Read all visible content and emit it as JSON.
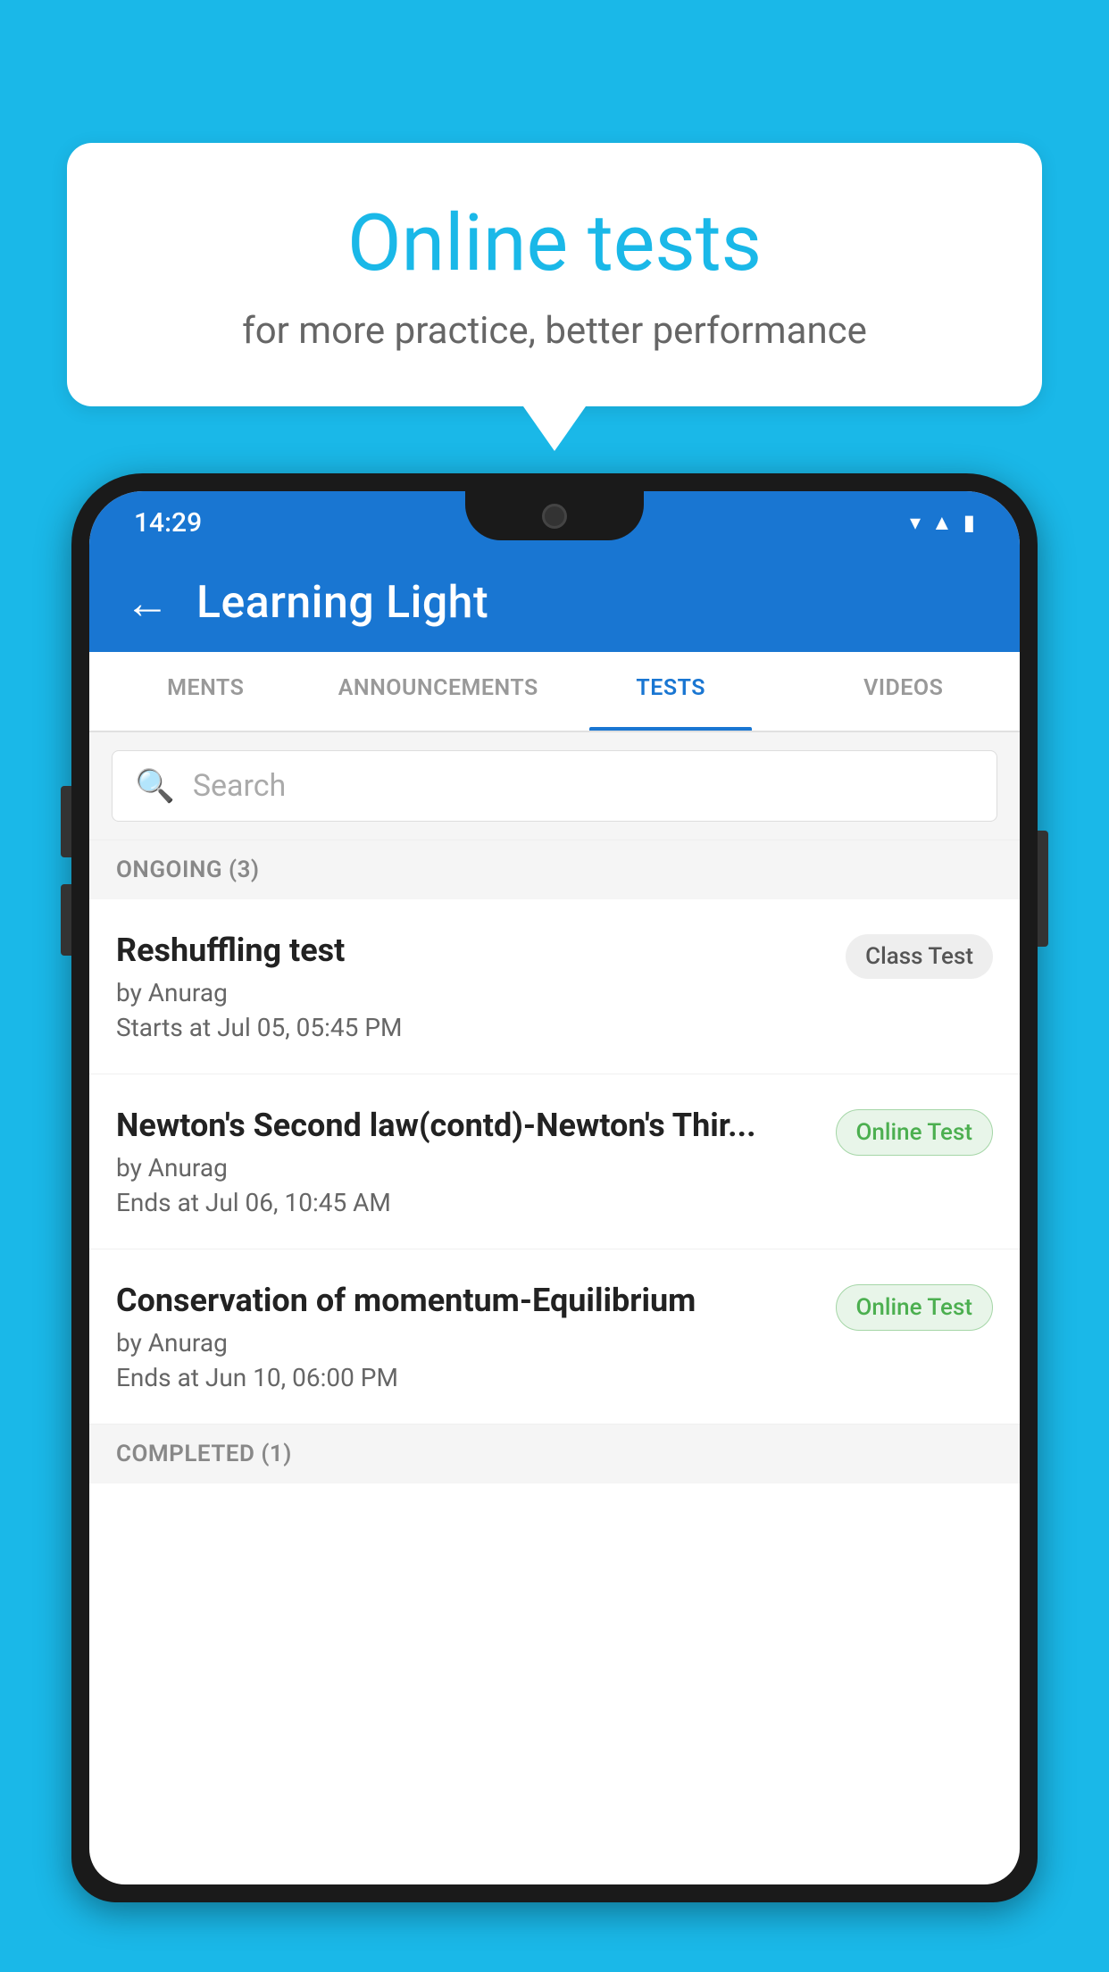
{
  "background_color": "#1ab8e8",
  "speech_bubble": {
    "title": "Online tests",
    "subtitle": "for more practice, better performance"
  },
  "phone": {
    "status_bar": {
      "time": "14:29",
      "icons": [
        "wifi",
        "signal",
        "battery"
      ]
    },
    "app_bar": {
      "title": "Learning Light",
      "back_label": "←"
    },
    "tabs": [
      {
        "label": "MENTS",
        "active": false
      },
      {
        "label": "ANNOUNCEMENTS",
        "active": false
      },
      {
        "label": "TESTS",
        "active": true
      },
      {
        "label": "VIDEOS",
        "active": false
      }
    ],
    "search": {
      "placeholder": "Search"
    },
    "sections": [
      {
        "header": "ONGOING (3)",
        "items": [
          {
            "title": "Reshuffling test",
            "author": "by Anurag",
            "date": "Starts at  Jul 05, 05:45 PM",
            "badge": "Class Test",
            "badge_type": "class"
          },
          {
            "title": "Newton's Second law(contd)-Newton's Thir...",
            "author": "by Anurag",
            "date": "Ends at  Jul 06, 10:45 AM",
            "badge": "Online Test",
            "badge_type": "online"
          },
          {
            "title": "Conservation of momentum-Equilibrium",
            "author": "by Anurag",
            "date": "Ends at  Jun 10, 06:00 PM",
            "badge": "Online Test",
            "badge_type": "online"
          }
        ]
      },
      {
        "header": "COMPLETED (1)",
        "items": []
      }
    ]
  }
}
